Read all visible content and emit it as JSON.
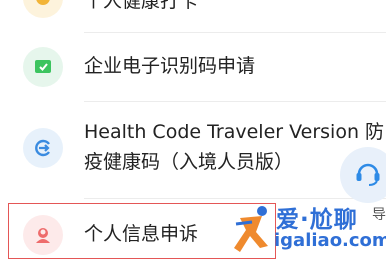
{
  "list": {
    "items": [
      {
        "label": "个人健康打卡",
        "icon": "health-checkin-icon",
        "icon_bg": "#fdf3dc",
        "icon_color": "#f2b437"
      },
      {
        "label": "企业电子识别码申请",
        "icon": "enterprise-code-icon",
        "icon_bg": "#e6f6ec",
        "icon_color": "#3cc45f"
      },
      {
        "label_line1": "Health Code Traveler Version 防",
        "label_line2": "疫健康码（入境人员版）",
        "icon": "traveler-code-icon",
        "icon_bg": "#e7f1fb",
        "icon_color": "#3a8be0"
      },
      {
        "label": "个人信息申诉",
        "icon": "person-appeal-icon",
        "icon_bg": "#fdeaea",
        "icon_color": "#ee6c6c"
      }
    ]
  },
  "customer_service": {
    "icon": "headset-icon",
    "color": "#2d8ae6"
  },
  "watermark": {
    "title": "爱·尬聊",
    "url": "igaliao.com",
    "extra": "导",
    "color": "#2f6fd6"
  },
  "highlight_color": "#e45656"
}
